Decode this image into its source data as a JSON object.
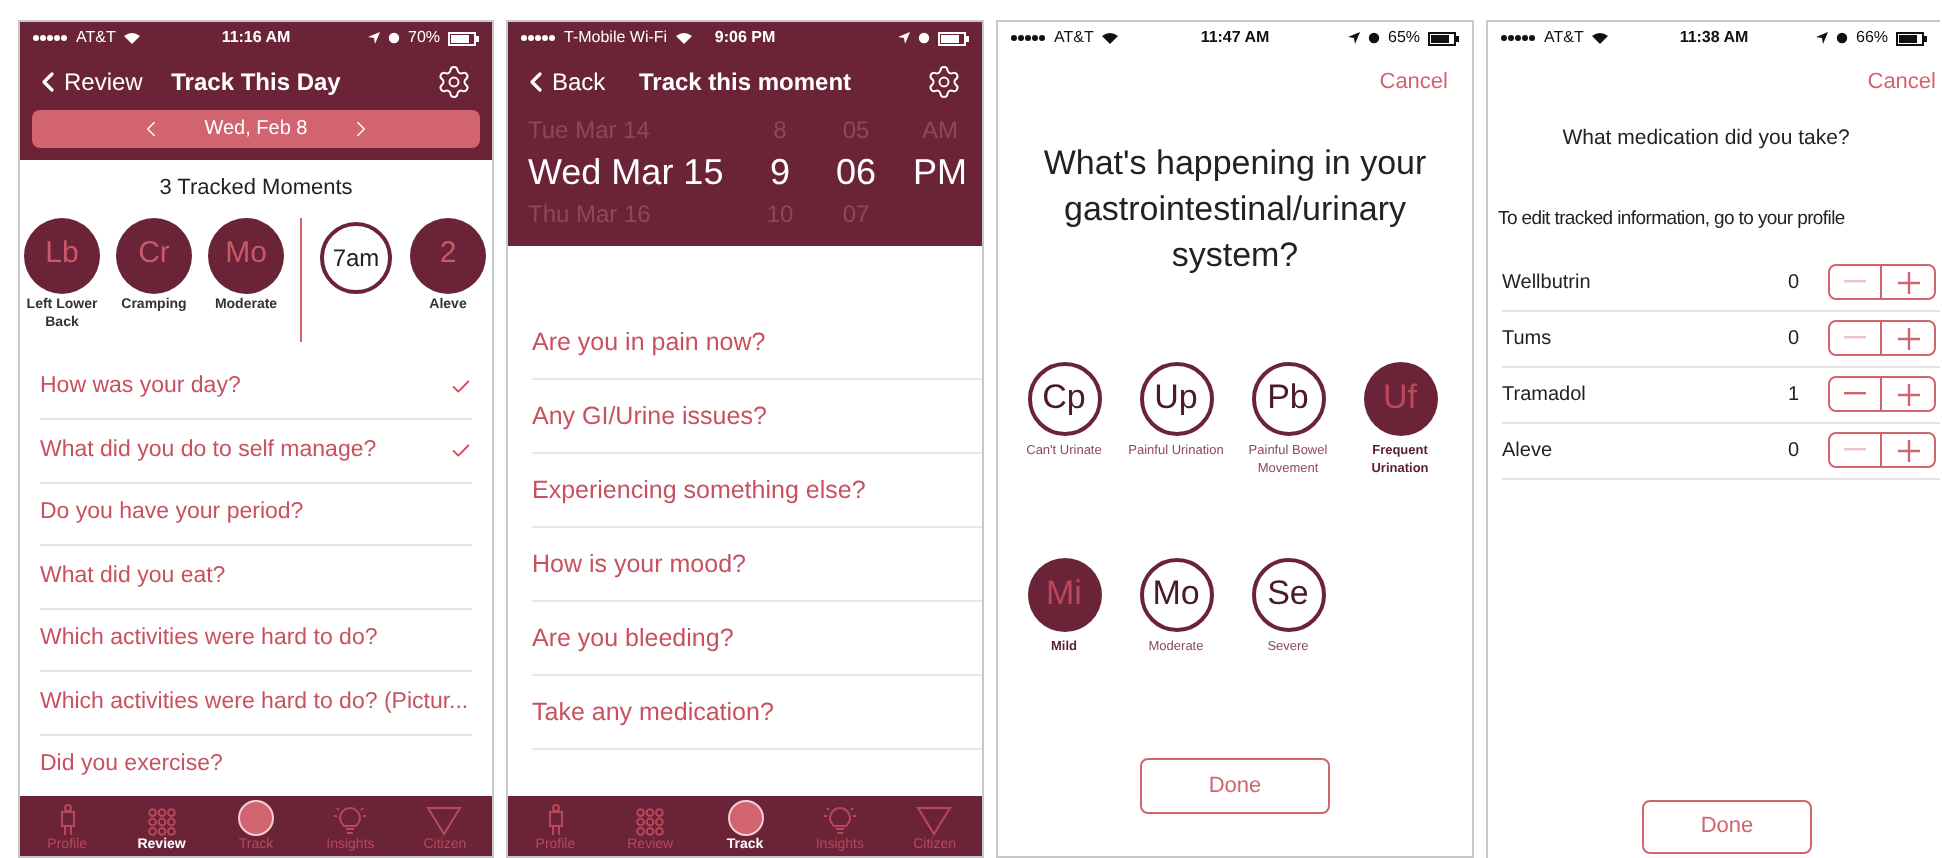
{
  "day_screen": {
    "status": {
      "carrier": "AT&T",
      "time": "11:16 AM",
      "battery": "70%"
    },
    "back": "Review",
    "title": "Track This Day",
    "date": "Wed, Feb 8",
    "summary": "3 Tracked Moments",
    "moments": [
      {
        "kind": "symptom",
        "abbr": "Lb",
        "label": "Left Lower Back"
      },
      {
        "kind": "symptom",
        "abbr": "Cr",
        "label": "Cramping"
      },
      {
        "kind": "symptom",
        "abbr": "Mo",
        "label": "Moderate"
      },
      {
        "kind": "time",
        "abbr": "7am"
      },
      {
        "kind": "symptom",
        "abbr": "2",
        "label": "Aleve"
      }
    ],
    "questions": [
      {
        "text": "How was your day?",
        "checked": true
      },
      {
        "text": "What did you do to self manage?",
        "checked": true
      },
      {
        "text": "Do you have your period?",
        "checked": false
      },
      {
        "text": "What did you eat?",
        "checked": false
      },
      {
        "text": "Which activities were hard to do?",
        "checked": false
      },
      {
        "text": "Which activities were hard to do? (Pictur...",
        "checked": false
      },
      {
        "text": "Did you exercise?",
        "checked": false
      }
    ],
    "tabs": [
      {
        "label": "Profile",
        "selected": false
      },
      {
        "label": "Review",
        "selected": true
      },
      {
        "label": "Track",
        "selected": false
      },
      {
        "label": "Insights",
        "selected": false
      },
      {
        "label": "Citizen",
        "selected": false
      }
    ]
  },
  "moment_screen": {
    "status": {
      "carrier": "T-Mobile Wi-Fi",
      "time": "9:06 PM"
    },
    "back": "Back",
    "title": "Track this moment",
    "picker": [
      {
        "cells": [
          "Tue Mar 14",
          "8",
          "05",
          "AM"
        ],
        "selected": false
      },
      {
        "cells": [
          "Wed Mar 15",
          "9",
          "06",
          "PM"
        ],
        "selected": true
      },
      {
        "cells": [
          "Thu Mar 16",
          "10",
          "07"
        ],
        "selected": false
      }
    ],
    "questions": [
      "Are you in pain now?",
      "Any GI/Urine issues?",
      "Experiencing something else?",
      "How is your mood?",
      "Are you bleeding?",
      "Take any medication?"
    ],
    "tabs": [
      {
        "label": "Profile",
        "selected": false
      },
      {
        "label": "Review",
        "selected": false
      },
      {
        "label": "Track",
        "selected": true
      },
      {
        "label": "Insights",
        "selected": false
      },
      {
        "label": "Citizen",
        "selected": false
      }
    ]
  },
  "symptom_screen": {
    "status": {
      "carrier": "AT&T",
      "time": "11:47 AM",
      "battery": "65%"
    },
    "cancel": "Cancel",
    "question": "What's happening in your gastrointestinal/urinary system?",
    "symptoms": [
      {
        "abbr": "Cp",
        "label": "Can't Urinate",
        "selected": false
      },
      {
        "abbr": "Up",
        "label": "Painful Urination",
        "selected": false
      },
      {
        "abbr": "Pb",
        "label": "Painful Bowel Movement",
        "selected": false
      },
      {
        "abbr": "Uf",
        "label": "Frequent Urination",
        "selected": true
      }
    ],
    "severities": [
      {
        "abbr": "Mi",
        "label": "Mild",
        "selected": true
      },
      {
        "abbr": "Mo",
        "label": "Moderate",
        "selected": false
      },
      {
        "abbr": "Se",
        "label": "Severe",
        "selected": false
      }
    ],
    "done": "Done"
  },
  "medication_screen": {
    "status": {
      "carrier": "AT&T",
      "time": "11:38 AM",
      "battery": "66%"
    },
    "cancel": "Cancel",
    "question": "What medication did you take?",
    "hint": "To edit tracked information, go to your profile",
    "medications": [
      {
        "name": "Wellbutrin",
        "count": "0",
        "minus_disabled": true
      },
      {
        "name": "Tums",
        "count": "0",
        "minus_disabled": true
      },
      {
        "name": "Tramadol",
        "count": "1",
        "minus_disabled": false
      },
      {
        "name": "Aleve",
        "count": "0",
        "minus_disabled": true
      }
    ],
    "done": "Done"
  }
}
